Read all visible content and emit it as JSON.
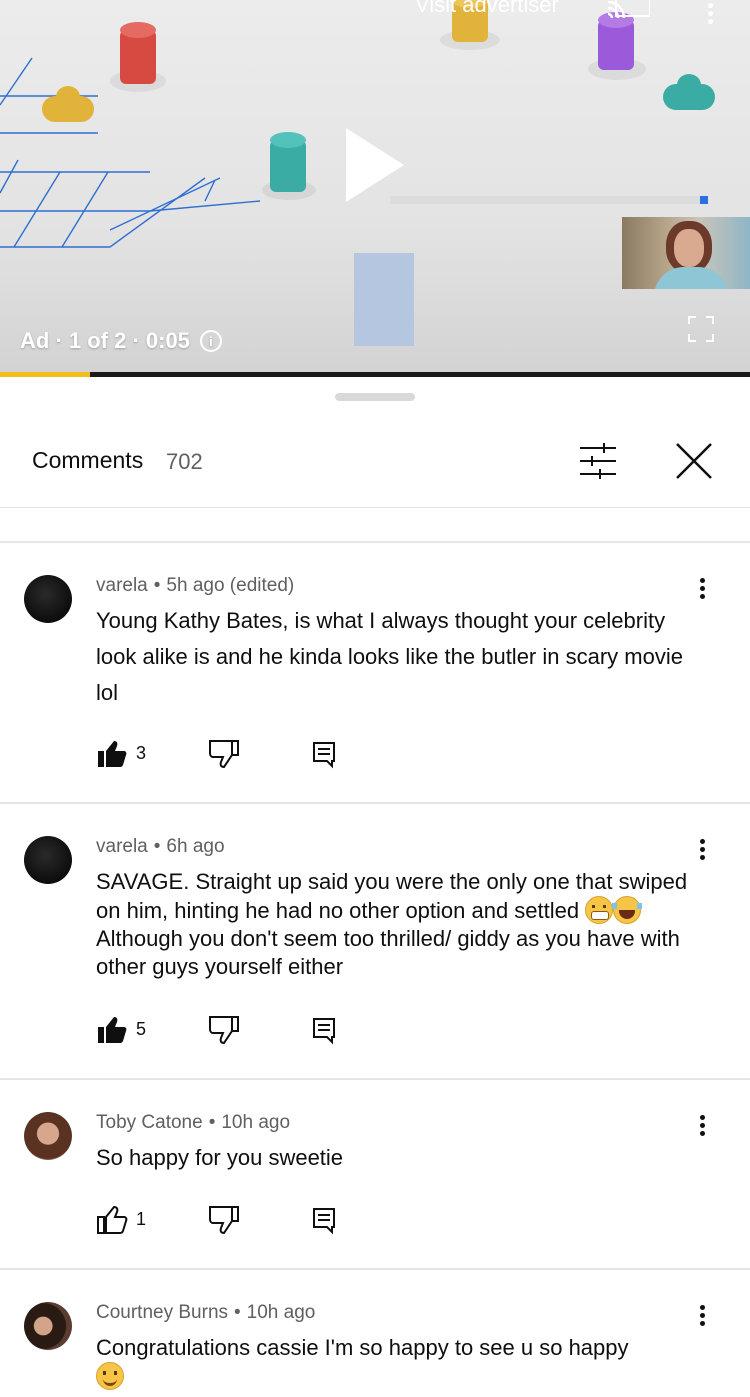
{
  "ad": {
    "visit_label": "Visit advertiser",
    "status_label": "Ad · 1 of 2 · 0:05",
    "progress_fraction": 0.12,
    "accent": "#f2bf1e",
    "icons": [
      "cast-icon",
      "more-vertical-icon",
      "play-icon",
      "fullscreen-icon",
      "info-icon"
    ]
  },
  "comments_panel": {
    "title": "Comments",
    "count": "702",
    "icons": [
      "filter-icon",
      "close-icon"
    ]
  },
  "comments": [
    {
      "author": "varela",
      "time": "5h ago (edited)",
      "text": "Young Kathy Bates, is what I always thought  your celebrity look alike is and he kinda looks like the butler in scary movie lol",
      "likes": "3",
      "liked": true
    },
    {
      "author": "varela",
      "time": "6h ago",
      "text_before_emoji": "SAVAGE. Straight up said you were the only one that swiped on him, hinting he had no other option and settled",
      "text_after_emoji": "Although you don't seem too thrilled/ giddy as you have with other guys yourself either",
      "emojis": [
        "grimacing-face",
        "face-with-tears-of-joy"
      ],
      "likes": "5",
      "liked": true
    },
    {
      "author": "Toby Catone",
      "time": "10h ago",
      "text": "So happy for you sweetie",
      "likes": "1",
      "liked": false
    },
    {
      "author": "Courtney Burns",
      "time": "10h ago",
      "text": "Congratulations  cassie I'm so happy  to  see u so happy",
      "emojis": [
        "smiling-face"
      ]
    }
  ]
}
